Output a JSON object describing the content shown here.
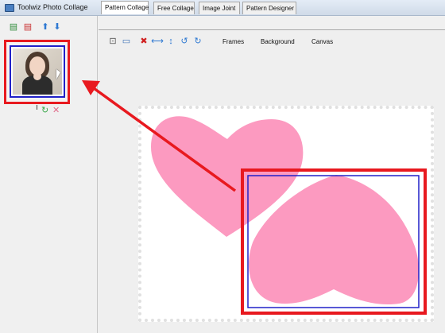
{
  "window": {
    "title": "Toolwiz Photo Collage"
  },
  "left_panel": {
    "tools": [
      {
        "icon": "add-photo-icon",
        "glyph": "▤",
        "color": "#2e8b3a"
      },
      {
        "icon": "remove-photo-icon",
        "glyph": "▤",
        "color": "#c83030"
      },
      {
        "icon": "move-up-icon",
        "glyph": "⬆",
        "color": "#2f79d2"
      },
      {
        "icon": "move-down-icon",
        "glyph": "⬇",
        "color": "#2f79d2"
      }
    ]
  },
  "tabs": [
    {
      "label": "Pattern Collage",
      "active": true
    },
    {
      "label": "Free Collage",
      "active": false
    },
    {
      "label": "Image Joint",
      "active": false
    },
    {
      "label": "Pattern Designer",
      "active": false
    }
  ],
  "toolbar": {
    "icons": [
      {
        "name": "clip-icon",
        "glyph": "⊡",
        "color": "#555"
      },
      {
        "name": "fit-icon",
        "glyph": "▭",
        "color": "#3a6fb5"
      },
      {
        "name": "delete-icon",
        "glyph": "✖",
        "color": "#d02020"
      },
      {
        "name": "flip-horizontal-icon",
        "glyph": "⟷",
        "color": "#2f79d2"
      },
      {
        "name": "flip-vertical-icon",
        "glyph": "↕",
        "color": "#2f79d2"
      },
      {
        "name": "rotate-left-icon",
        "glyph": "↺",
        "color": "#2f79d2"
      },
      {
        "name": "rotate-right-icon",
        "glyph": "↻",
        "color": "#2f79d2"
      }
    ],
    "frames_label": "Frames",
    "background_label": "Background",
    "canvas_label": "Canvas"
  },
  "colors": {
    "heart": "#fc9ac0",
    "highlight_red": "#e8191f",
    "selection_blue": "#2020c8"
  }
}
